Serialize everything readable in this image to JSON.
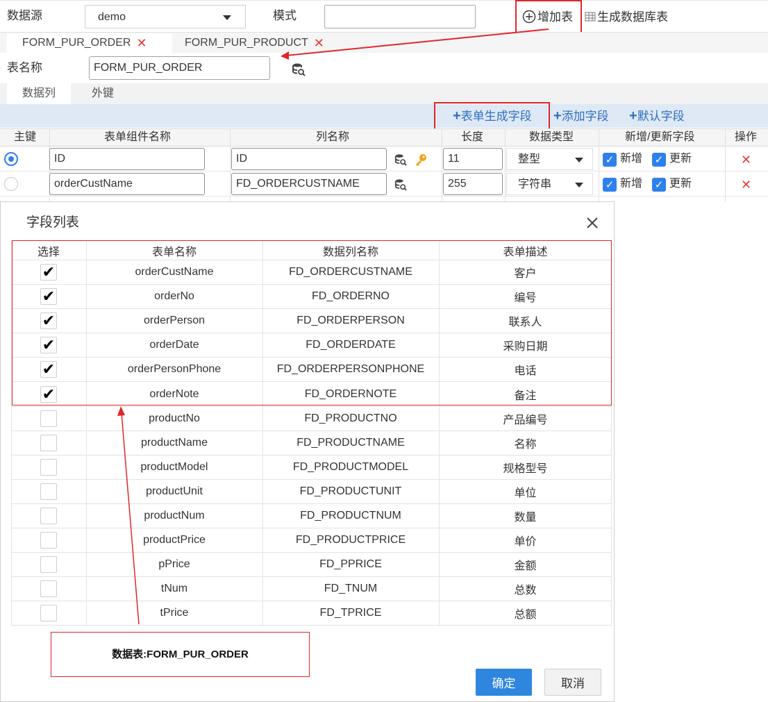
{
  "top": {
    "datasource_label": "数据源",
    "datasource_value": "demo",
    "mode_label": "模式",
    "mode_value": "",
    "add_table": "增加表",
    "gen_db_table": "生成数据库表"
  },
  "tabs": [
    {
      "label": "FORM_PUR_ORDER"
    },
    {
      "label": "FORM_PUR_PRODUCT"
    }
  ],
  "table_name": {
    "label": "表名称",
    "value": "FORM_PUR_ORDER"
  },
  "subtabs": [
    "数据列",
    "外键"
  ],
  "toolbar": {
    "gen_from_form": "表单生成字段",
    "add_field": "添加字段",
    "default_field": "默认字段"
  },
  "grid": {
    "headers": [
      "主键",
      "表单组件名称",
      "列名称",
      "长度",
      "数据类型",
      "新增/更新字段",
      "操作"
    ],
    "rows": [
      {
        "component": "ID",
        "column": "ID",
        "length": "11",
        "type": "整型",
        "insert": "新增",
        "update": "更新"
      },
      {
        "component": "orderCustName",
        "column": "FD_ORDERCUSTNAME",
        "length": "255",
        "type": "字符串",
        "insert": "新增",
        "update": "更新"
      }
    ]
  },
  "modal": {
    "title": "字段列表",
    "headers": [
      "选择",
      "表单名称",
      "数据列名称",
      "表单描述"
    ],
    "rows": [
      {
        "checked": true,
        "form": "orderCustName",
        "column": "FD_ORDERCUSTNAME",
        "desc": "客户"
      },
      {
        "checked": true,
        "form": "orderNo",
        "column": "FD_ORDERNO",
        "desc": "编号"
      },
      {
        "checked": true,
        "form": "orderPerson",
        "column": "FD_ORDERPERSON",
        "desc": "联系人"
      },
      {
        "checked": true,
        "form": "orderDate",
        "column": "FD_ORDERDATE",
        "desc": "采购日期"
      },
      {
        "checked": true,
        "form": "orderPersonPhone",
        "column": "FD_ORDERPERSONPHONE",
        "desc": "电话"
      },
      {
        "checked": true,
        "form": "orderNote",
        "column": "FD_ORDERNOTE",
        "desc": "备注"
      },
      {
        "checked": false,
        "form": "productNo",
        "column": "FD_PRODUCTNO",
        "desc": "产品编号"
      },
      {
        "checked": false,
        "form": "productName",
        "column": "FD_PRODUCTNAME",
        "desc": "名称"
      },
      {
        "checked": false,
        "form": "productModel",
        "column": "FD_PRODUCTMODEL",
        "desc": "规格型号"
      },
      {
        "checked": false,
        "form": "productUnit",
        "column": "FD_PRODUCTUNIT",
        "desc": "单位"
      },
      {
        "checked": false,
        "form": "productNum",
        "column": "FD_PRODUCTNUM",
        "desc": "数量"
      },
      {
        "checked": false,
        "form": "productPrice",
        "column": "FD_PRODUCTPRICE",
        "desc": "单价"
      },
      {
        "checked": false,
        "form": "pPrice",
        "column": "FD_PPRICE",
        "desc": "金额"
      },
      {
        "checked": false,
        "form": "tNum",
        "column": "FD_TNUM",
        "desc": "总数"
      },
      {
        "checked": false,
        "form": "tPrice",
        "column": "FD_TPRICE",
        "desc": "总额"
      }
    ],
    "annotation": "数据表:FORM_PUR_ORDER",
    "ok": "确定",
    "cancel": "取消"
  },
  "colors": {
    "accent": "#2e86de",
    "annotation_red": "#e0262a",
    "header_bg": "#dfe9f5"
  }
}
